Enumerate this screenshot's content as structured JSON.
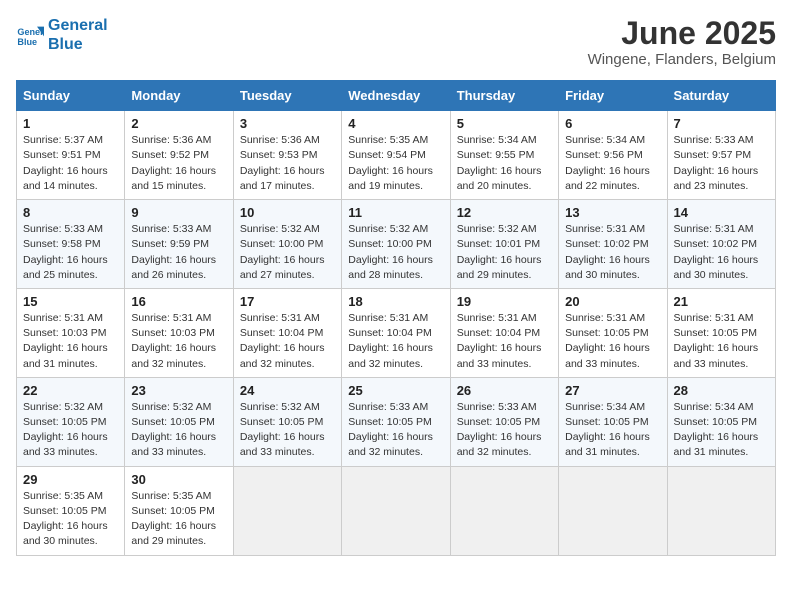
{
  "header": {
    "logo_line1": "General",
    "logo_line2": "Blue",
    "month_title": "June 2025",
    "location": "Wingene, Flanders, Belgium"
  },
  "weekdays": [
    "Sunday",
    "Monday",
    "Tuesday",
    "Wednesday",
    "Thursday",
    "Friday",
    "Saturday"
  ],
  "weeks": [
    [
      {
        "day": "1",
        "sunrise": "Sunrise: 5:37 AM",
        "sunset": "Sunset: 9:51 PM",
        "daylight": "Daylight: 16 hours and 14 minutes."
      },
      {
        "day": "2",
        "sunrise": "Sunrise: 5:36 AM",
        "sunset": "Sunset: 9:52 PM",
        "daylight": "Daylight: 16 hours and 15 minutes."
      },
      {
        "day": "3",
        "sunrise": "Sunrise: 5:36 AM",
        "sunset": "Sunset: 9:53 PM",
        "daylight": "Daylight: 16 hours and 17 minutes."
      },
      {
        "day": "4",
        "sunrise": "Sunrise: 5:35 AM",
        "sunset": "Sunset: 9:54 PM",
        "daylight": "Daylight: 16 hours and 19 minutes."
      },
      {
        "day": "5",
        "sunrise": "Sunrise: 5:34 AM",
        "sunset": "Sunset: 9:55 PM",
        "daylight": "Daylight: 16 hours and 20 minutes."
      },
      {
        "day": "6",
        "sunrise": "Sunrise: 5:34 AM",
        "sunset": "Sunset: 9:56 PM",
        "daylight": "Daylight: 16 hours and 22 minutes."
      },
      {
        "day": "7",
        "sunrise": "Sunrise: 5:33 AM",
        "sunset": "Sunset: 9:57 PM",
        "daylight": "Daylight: 16 hours and 23 minutes."
      }
    ],
    [
      {
        "day": "8",
        "sunrise": "Sunrise: 5:33 AM",
        "sunset": "Sunset: 9:58 PM",
        "daylight": "Daylight: 16 hours and 25 minutes."
      },
      {
        "day": "9",
        "sunrise": "Sunrise: 5:33 AM",
        "sunset": "Sunset: 9:59 PM",
        "daylight": "Daylight: 16 hours and 26 minutes."
      },
      {
        "day": "10",
        "sunrise": "Sunrise: 5:32 AM",
        "sunset": "Sunset: 10:00 PM",
        "daylight": "Daylight: 16 hours and 27 minutes."
      },
      {
        "day": "11",
        "sunrise": "Sunrise: 5:32 AM",
        "sunset": "Sunset: 10:00 PM",
        "daylight": "Daylight: 16 hours and 28 minutes."
      },
      {
        "day": "12",
        "sunrise": "Sunrise: 5:32 AM",
        "sunset": "Sunset: 10:01 PM",
        "daylight": "Daylight: 16 hours and 29 minutes."
      },
      {
        "day": "13",
        "sunrise": "Sunrise: 5:31 AM",
        "sunset": "Sunset: 10:02 PM",
        "daylight": "Daylight: 16 hours and 30 minutes."
      },
      {
        "day": "14",
        "sunrise": "Sunrise: 5:31 AM",
        "sunset": "Sunset: 10:02 PM",
        "daylight": "Daylight: 16 hours and 30 minutes."
      }
    ],
    [
      {
        "day": "15",
        "sunrise": "Sunrise: 5:31 AM",
        "sunset": "Sunset: 10:03 PM",
        "daylight": "Daylight: 16 hours and 31 minutes."
      },
      {
        "day": "16",
        "sunrise": "Sunrise: 5:31 AM",
        "sunset": "Sunset: 10:03 PM",
        "daylight": "Daylight: 16 hours and 32 minutes."
      },
      {
        "day": "17",
        "sunrise": "Sunrise: 5:31 AM",
        "sunset": "Sunset: 10:04 PM",
        "daylight": "Daylight: 16 hours and 32 minutes."
      },
      {
        "day": "18",
        "sunrise": "Sunrise: 5:31 AM",
        "sunset": "Sunset: 10:04 PM",
        "daylight": "Daylight: 16 hours and 32 minutes."
      },
      {
        "day": "19",
        "sunrise": "Sunrise: 5:31 AM",
        "sunset": "Sunset: 10:04 PM",
        "daylight": "Daylight: 16 hours and 33 minutes."
      },
      {
        "day": "20",
        "sunrise": "Sunrise: 5:31 AM",
        "sunset": "Sunset: 10:05 PM",
        "daylight": "Daylight: 16 hours and 33 minutes."
      },
      {
        "day": "21",
        "sunrise": "Sunrise: 5:31 AM",
        "sunset": "Sunset: 10:05 PM",
        "daylight": "Daylight: 16 hours and 33 minutes."
      }
    ],
    [
      {
        "day": "22",
        "sunrise": "Sunrise: 5:32 AM",
        "sunset": "Sunset: 10:05 PM",
        "daylight": "Daylight: 16 hours and 33 minutes."
      },
      {
        "day": "23",
        "sunrise": "Sunrise: 5:32 AM",
        "sunset": "Sunset: 10:05 PM",
        "daylight": "Daylight: 16 hours and 33 minutes."
      },
      {
        "day": "24",
        "sunrise": "Sunrise: 5:32 AM",
        "sunset": "Sunset: 10:05 PM",
        "daylight": "Daylight: 16 hours and 33 minutes."
      },
      {
        "day": "25",
        "sunrise": "Sunrise: 5:33 AM",
        "sunset": "Sunset: 10:05 PM",
        "daylight": "Daylight: 16 hours and 32 minutes."
      },
      {
        "day": "26",
        "sunrise": "Sunrise: 5:33 AM",
        "sunset": "Sunset: 10:05 PM",
        "daylight": "Daylight: 16 hours and 32 minutes."
      },
      {
        "day": "27",
        "sunrise": "Sunrise: 5:34 AM",
        "sunset": "Sunset: 10:05 PM",
        "daylight": "Daylight: 16 hours and 31 minutes."
      },
      {
        "day": "28",
        "sunrise": "Sunrise: 5:34 AM",
        "sunset": "Sunset: 10:05 PM",
        "daylight": "Daylight: 16 hours and 31 minutes."
      }
    ],
    [
      {
        "day": "29",
        "sunrise": "Sunrise: 5:35 AM",
        "sunset": "Sunset: 10:05 PM",
        "daylight": "Daylight: 16 hours and 30 minutes."
      },
      {
        "day": "30",
        "sunrise": "Sunrise: 5:35 AM",
        "sunset": "Sunset: 10:05 PM",
        "daylight": "Daylight: 16 hours and 29 minutes."
      },
      null,
      null,
      null,
      null,
      null
    ]
  ]
}
